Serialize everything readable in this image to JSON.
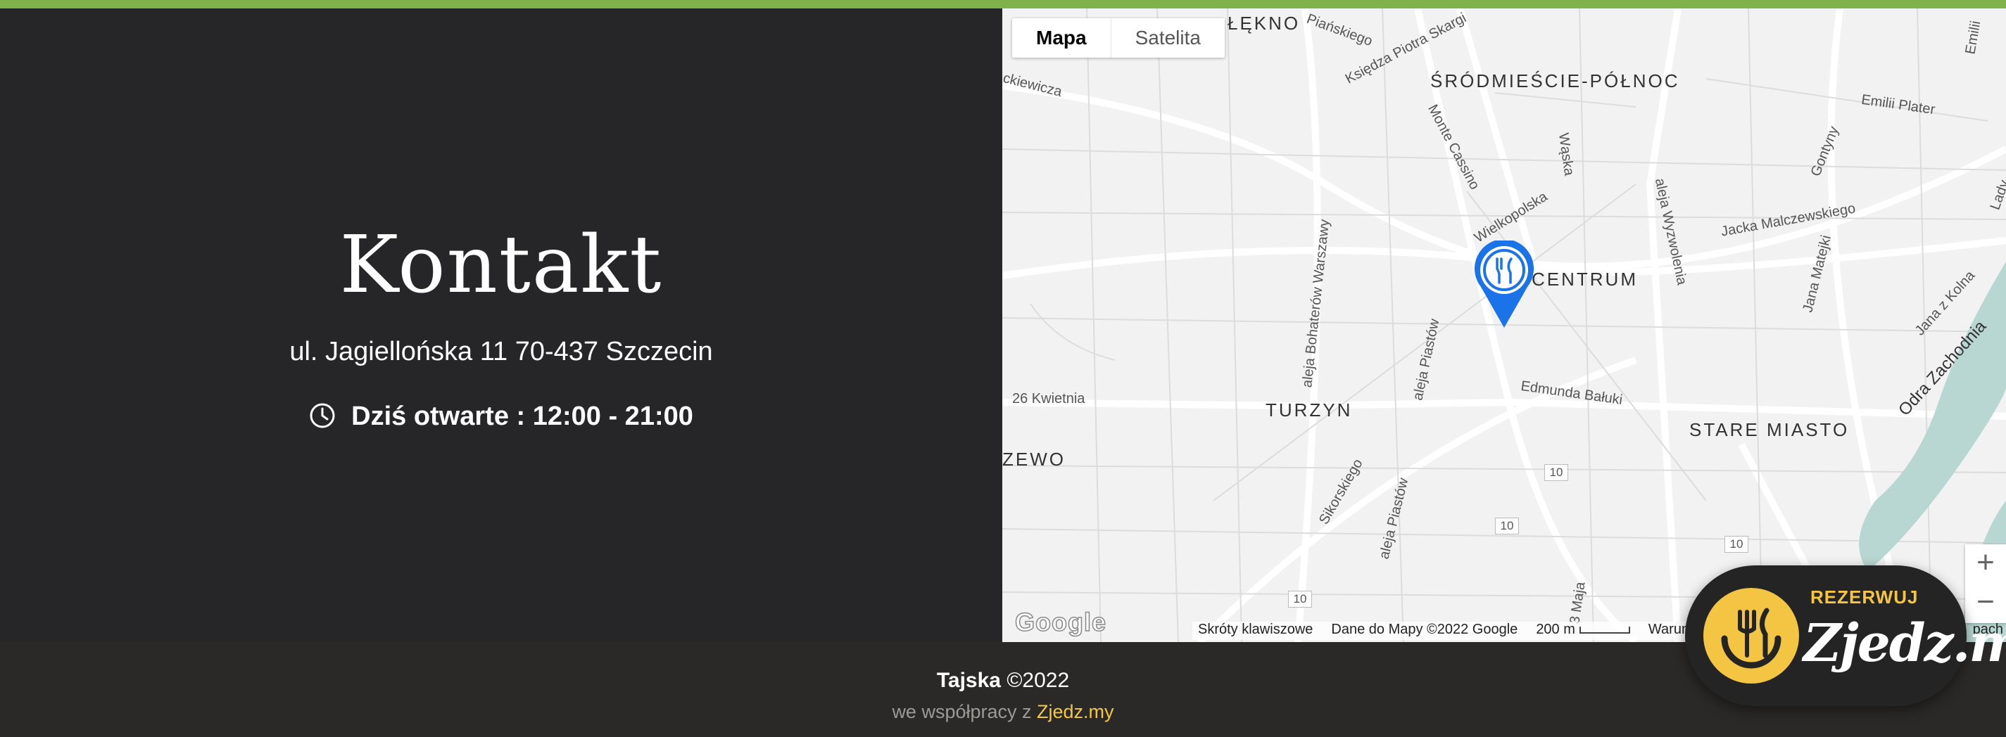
{
  "contact": {
    "title": "Kontakt",
    "address": "ul. Jagiellońska 11 70-437 Szczecin",
    "hours": "Dziś otwarte : 12:00 - 21:00",
    "clock_icon": "clock-icon"
  },
  "map": {
    "type_options": [
      "Mapa",
      "Satelita"
    ],
    "selected_type": "Mapa",
    "districts": {
      "lekno": "ŁĘKNO",
      "srodmiescie": "ŚRÓDMIEŚCIE-PÓŁNOC",
      "centrum": "CENTRUM",
      "turzyn": "TURZYN",
      "stare_miasto": "STARE MIASTO",
      "zewo": "ZEWO"
    },
    "streets": {
      "pianskiego": "Piańskiego",
      "skargi": "Księdza Piotra Skargi",
      "kiewicza": "ckiewicza",
      "monte_cassino": "Monte Cassino",
      "waska": "Wąska",
      "wielkopolska": "Wielkopolska",
      "wyzwolenia": "aleja Wyzwolenia",
      "malczewskiego": "Jacka Malczewskiego",
      "plater": "Emilii Plater",
      "emilii": "Emilii",
      "gontyny": "Gontyny",
      "lady": "Lady",
      "bohaterow": "aleja Bohaterów Warszawy",
      "piastow1": "aleja Piastów",
      "piastow2": "aleja Piastów",
      "kwietnia": "26 Kwietnia",
      "baluki": "Edmunda Bałuki",
      "matejki": "Jana Matejki",
      "kolna": "Jana z Kolna",
      "odra": "Odra Zachodnia",
      "sikorskiego": "Sikorskiego",
      "maja": "3 Maja"
    },
    "route_badge": "10",
    "google_logo": "Google",
    "shortcuts": "Skróty klawiszowe",
    "data_credit": "Dane do Mapy ©2022 Google",
    "scale": "200 m",
    "terms": "Warun",
    "report": "pach",
    "zoom_in": "+",
    "zoom_out": "−"
  },
  "footer": {
    "brand": "Tajska",
    "copyright": "©2022",
    "credit_prefix": "we współpracy z ",
    "credit_link": "Zjedz.my"
  },
  "reserve_widget": {
    "cta": "REZERWUJ",
    "brand": "Zjedz.my"
  },
  "colors": {
    "accent_green": "#7fb24a",
    "brand_yellow": "#f4c542",
    "pin_blue": "#1a73e8"
  }
}
